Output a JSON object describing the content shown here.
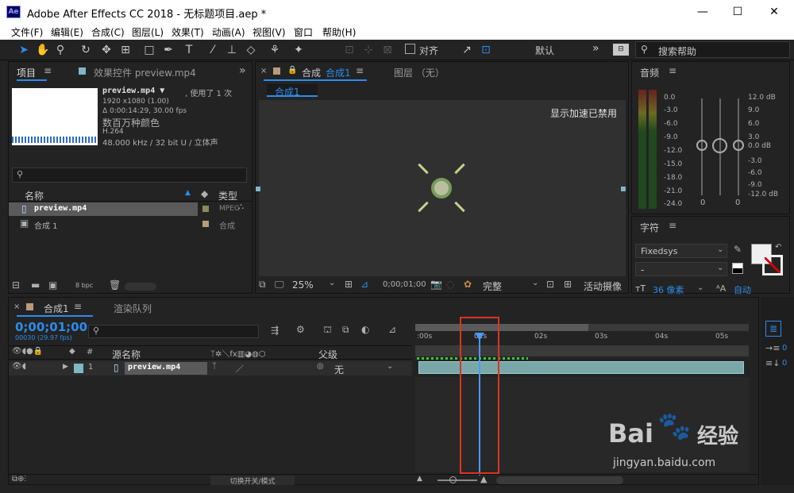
{
  "app": {
    "title": "Adobe After Effects CC 2018 - 无标题项目.aep *",
    "icon_text": "Ae"
  },
  "menu": [
    "文件(F)",
    "编辑(E)",
    "合成(C)",
    "图层(L)",
    "效果(T)",
    "动画(A)",
    "视图(V)",
    "窗口",
    "帮助(H)"
  ],
  "toolbar": {
    "snap_label": "对齐",
    "workspace": "默认",
    "search_placeholder": "搜索帮助"
  },
  "project": {
    "tab": "项目",
    "effects_tab": "效果控件 preview.mp4",
    "file_name": "preview.mp4 ▼",
    "used": ", 使用了 1 次",
    "res": "1920 x1080 (1.00)",
    "duration": "Δ 0:00:14:29, 30.00 fps",
    "colors": "数百万种颜色",
    "codec": "H.264",
    "audio": "48.000 kHz / 32 bit U / 立体声",
    "col_name": "名称",
    "col_type": "类型",
    "items": [
      {
        "name": "preview.mp4",
        "type": "MPEG"
      },
      {
        "name": "合成 1",
        "type": "合成"
      }
    ],
    "bpc": "8 bpc"
  },
  "comp": {
    "tab": "合成",
    "comp_name": "合成1",
    "layer_tab": "图层 （无）",
    "breadcrumb": "合成1",
    "accel_msg": "显示加速已禁用",
    "zoom": "25%",
    "timecode": "0;00;01;00",
    "quality": "完整",
    "camera": "活动摄像"
  },
  "audio": {
    "tab": "音频",
    "left_scale": [
      "0.0",
      "-3.0",
      "-6.0",
      "-9.0",
      "-12.0",
      "-15.0",
      "-18.0",
      "-21.0",
      "-24.0"
    ],
    "right_scale": [
      "12.0 dB",
      "9.0",
      "6.0",
      "3.0",
      "0.0 dB",
      "-3.0",
      "-6.0",
      "-9.0",
      "-12.0 dB"
    ],
    "left_val": "0",
    "right_val": "0"
  },
  "character": {
    "tab": "字符",
    "font": "Fixedsys",
    "style": "-",
    "size": "36 像素",
    "auto": "自动"
  },
  "timeline": {
    "tab": "合成1",
    "render_tab": "渲染队列",
    "timecode": "0;00;01;00",
    "frames": "00030 (29.97 fps)",
    "col_source": "源名称",
    "col_parent": "父级",
    "layer_num": "1",
    "layer_name": "preview.mp4",
    "parent_val": "无",
    "ruler": [
      ":00s",
      "01s",
      "02s",
      "03s",
      "04s",
      "05s"
    ],
    "footer": "切换开关/模式"
  },
  "right_dock": {
    "val1": "0",
    "val2": "0"
  },
  "watermark": {
    "brand": "Bai",
    "brand2": "经验",
    "url": "jingyan.baidu.com"
  }
}
